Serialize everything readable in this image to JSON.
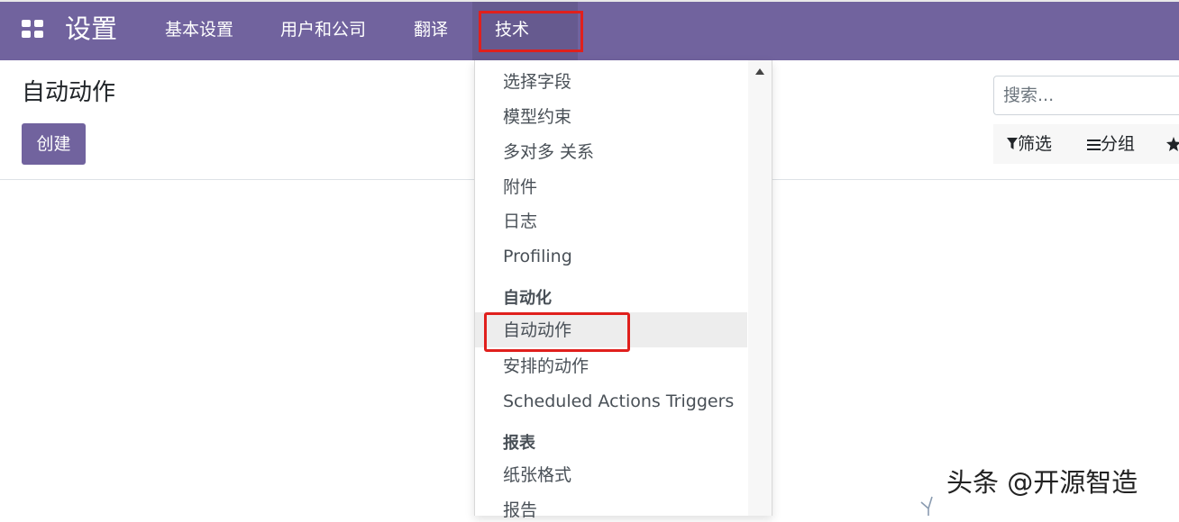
{
  "navbar": {
    "brand": "设置",
    "menu": [
      "基本设置",
      "用户和公司",
      "翻译",
      "技术"
    ]
  },
  "control_panel": {
    "breadcrumb": "自动动作",
    "create_label": "创建",
    "search_placeholder": "搜索...",
    "filter_label": "筛选",
    "group_label": "分组"
  },
  "dropdown": {
    "items_top": [
      "选择字段",
      "模型约束",
      "多对多 关系",
      "附件",
      "日志",
      "Profiling"
    ],
    "section_automation": "自动化",
    "automation_items": [
      "自动动作",
      "安排的动作",
      "Scheduled Actions Triggers"
    ],
    "section_reports": "报表",
    "report_items": [
      "纸张格式",
      "报告"
    ]
  },
  "watermark": "头条 @开源智造",
  "colors": {
    "navbar": "#71639e",
    "primary_button": "#71639e",
    "highlight_box": "#e0201d"
  }
}
